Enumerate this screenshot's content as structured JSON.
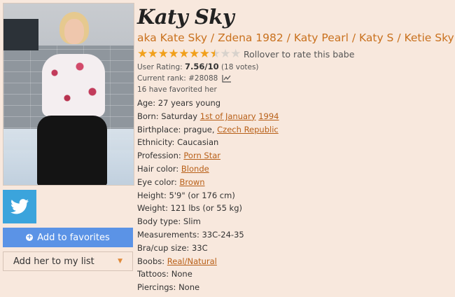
{
  "profile": {
    "name": "Katy Sky",
    "aka": "aka Kate Sky / Zdena 1982 / Katy Pearl / Katy S / Ketie Sky"
  },
  "rating": {
    "filled_stars": 7.5,
    "total_stars": 10,
    "rollover_text": "Rollover to rate this babe",
    "user_rating_label": "User Rating:",
    "user_rating_value": "7.56/10",
    "votes": "(18 votes)",
    "rank_text": "Current rank: #28088",
    "favorited_text": "16 have favorited her"
  },
  "actions": {
    "favorites_label": "Add to favorites",
    "mylist_label": "Add her to my list"
  },
  "facts": {
    "age_label": "Age:",
    "age_value": "27 years young",
    "born_label": "Born:",
    "born_day": "Saturday",
    "born_date": "1st of January",
    "born_year": "1994",
    "birthplace_label": "Birthplace:",
    "birthplace_city": "prague,",
    "birthplace_country": "Czech Republic",
    "ethnicity_label": "Ethnicity:",
    "ethnicity_value": "Caucasian",
    "profession_label": "Profession:",
    "profession_value": "Porn Star",
    "hair_label": "Hair color:",
    "hair_value": "Blonde",
    "eye_label": "Eye color:",
    "eye_value": "Brown",
    "height_label": "Height:",
    "height_value": "5'9\" (or 176 cm)",
    "weight_label": "Weight:",
    "weight_value": "121 lbs (or 55 kg)",
    "body_label": "Body type:",
    "body_value": "Slim",
    "measurements_label": "Measurements:",
    "measurements_value": "33C-24-35",
    "bra_label": "Bra/cup size:",
    "bra_value": "33C",
    "boobs_label": "Boobs:",
    "boobs_value": "Real/Natural",
    "tattoos_label": "Tattoos:",
    "tattoos_value": "None",
    "piercings_label": "Piercings:",
    "piercings_value": "None"
  },
  "colors": {
    "background": "#f8e8dd",
    "link": "#b85f17",
    "aka": "#c9711e",
    "star_on": "#f1a01b",
    "favorites_button": "#5b93e6",
    "twitter": "#3ba4dc"
  },
  "icons": {
    "twitter": "twitter-bird-icon",
    "rank": "line-chart-icon",
    "favorites": "plus-circle-icon",
    "dropdown": "caret-down-icon",
    "star": "star-icon"
  }
}
